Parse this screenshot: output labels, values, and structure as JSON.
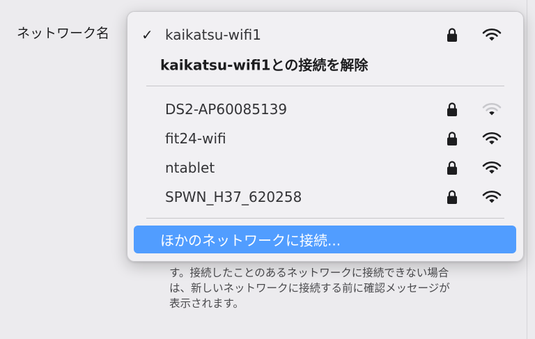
{
  "settings": {
    "network_name_label": "ネットワーク名",
    "description_lines": [
      "す。接続したことのあるネットワークに接続できない場合",
      "は、新しいネットワークに接続する前に確認メッセージが",
      "表示されます。"
    ]
  },
  "menu": {
    "current": {
      "check": "✓",
      "name": "kaikatsu-wifi1",
      "secured": true,
      "signal": 3
    },
    "disconnect_label": "kaikatsu-wifi1との接続を解除",
    "networks": [
      {
        "name": "DS2-AP60085139",
        "secured": true,
        "signal": 1
      },
      {
        "name": "fit24-wifi",
        "secured": true,
        "signal": 3
      },
      {
        "name": "ntablet",
        "secured": true,
        "signal": 3
      },
      {
        "name": "SPWN_H37_620258",
        "secured": true,
        "signal": 3
      }
    ],
    "other_network_label": "ほかのネットワークに接続..."
  },
  "colors": {
    "highlight": "#519dff",
    "icon_active": "#1d1d1f",
    "icon_dim": "#c8c8cc"
  },
  "icons": {
    "lock": "lock-icon",
    "wifi": "wifi-icon",
    "check": "checkmark-icon"
  }
}
